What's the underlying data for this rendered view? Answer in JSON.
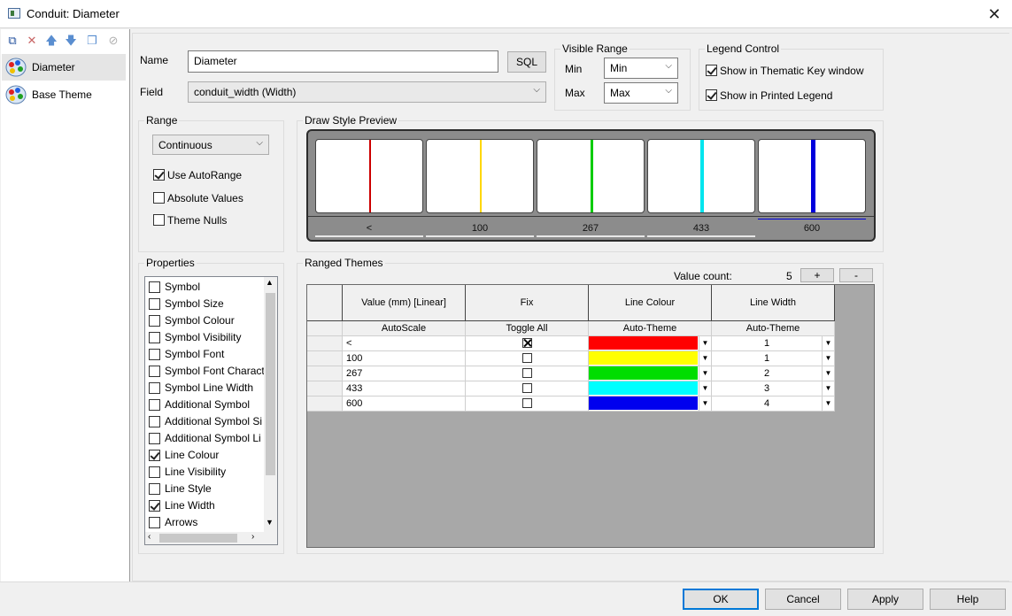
{
  "window": {
    "title": "Conduit: Diameter",
    "close_icon": "close-icon"
  },
  "left_panel": {
    "toolbar_icons": [
      "new-theme-icon",
      "delete-icon",
      "move-up-icon",
      "move-down-icon",
      "copy-icon",
      "disable-icon"
    ],
    "items": [
      {
        "label": "Diameter",
        "selected": true,
        "icon": "theme-palette-icon"
      },
      {
        "label": "Base Theme",
        "selected": false,
        "icon": "theme-palette-icon"
      }
    ]
  },
  "name": {
    "label": "Name",
    "value": "Diameter",
    "sql_button": "SQL"
  },
  "field": {
    "label": "Field",
    "value": "conduit_width (Width)"
  },
  "visible_range": {
    "title": "Visible Range",
    "min_label": "Min",
    "min_value": "Min",
    "max_label": "Max",
    "max_value": "Max"
  },
  "legend_control": {
    "title": "Legend Control",
    "show_thematic": {
      "label": "Show in Thematic Key window",
      "checked": true
    },
    "show_printed": {
      "label": "Show in Printed Legend",
      "checked": true
    }
  },
  "range": {
    "title": "Range",
    "mode": "Continuous",
    "use_autorange": {
      "label": "Use AutoRange",
      "checked": true
    },
    "absolute_values": {
      "label": "Absolute Values",
      "checked": false
    },
    "theme_nulls": {
      "label": "Theme Nulls",
      "checked": false
    }
  },
  "draw_style_preview": {
    "title": "Draw Style Preview",
    "cells": [
      {
        "label": "<",
        "color": "#cc0000",
        "width": 1
      },
      {
        "label": "100",
        "color": "#ffd700",
        "width": 1
      },
      {
        "label": "267",
        "color": "#00cc00",
        "width": 2
      },
      {
        "label": "433",
        "color": "#00e5ee",
        "width": 3
      },
      {
        "label": "600",
        "color": "#0000dd",
        "width": 4
      }
    ]
  },
  "properties": {
    "title": "Properties",
    "items": [
      {
        "label": "Symbol",
        "checked": false
      },
      {
        "label": "Symbol Size",
        "checked": false
      },
      {
        "label": "Symbol Colour",
        "checked": false
      },
      {
        "label": "Symbol Visibility",
        "checked": false
      },
      {
        "label": "Symbol Font",
        "checked": false
      },
      {
        "label": "Symbol Font Charact",
        "checked": false
      },
      {
        "label": "Symbol Line Width",
        "checked": false
      },
      {
        "label": "Additional Symbol",
        "checked": false
      },
      {
        "label": "Additional Symbol Si",
        "checked": false
      },
      {
        "label": "Additional Symbol Li",
        "checked": false
      },
      {
        "label": "Line Colour",
        "checked": true
      },
      {
        "label": "Line Visibility",
        "checked": false
      },
      {
        "label": "Line Style",
        "checked": false
      },
      {
        "label": "Line Width",
        "checked": true
      },
      {
        "label": "Arrows",
        "checked": false
      }
    ]
  },
  "ranged_themes": {
    "title": "Ranged Themes",
    "value_count_label": "Value count:",
    "value_count": "5",
    "add_button": "+",
    "remove_button": "-",
    "headers": [
      "Value (mm) [Linear]",
      "Fix",
      "Line Colour",
      "Line Width"
    ],
    "subheaders": [
      "AutoScale",
      "Toggle All",
      "Auto-Theme",
      "Auto-Theme"
    ],
    "rows": [
      {
        "value": "<",
        "fix": true,
        "colour": "#ff0000",
        "width": "1"
      },
      {
        "value": "100",
        "fix": false,
        "colour": "#ffff00",
        "width": "1"
      },
      {
        "value": "267",
        "fix": false,
        "colour": "#00dd00",
        "width": "2"
      },
      {
        "value": "433",
        "fix": false,
        "colour": "#00ffff",
        "width": "3"
      },
      {
        "value": "600",
        "fix": false,
        "colour": "#0000ee",
        "width": "4"
      }
    ]
  },
  "buttons": {
    "ok": "OK",
    "cancel": "Cancel",
    "apply": "Apply",
    "help": "Help"
  }
}
